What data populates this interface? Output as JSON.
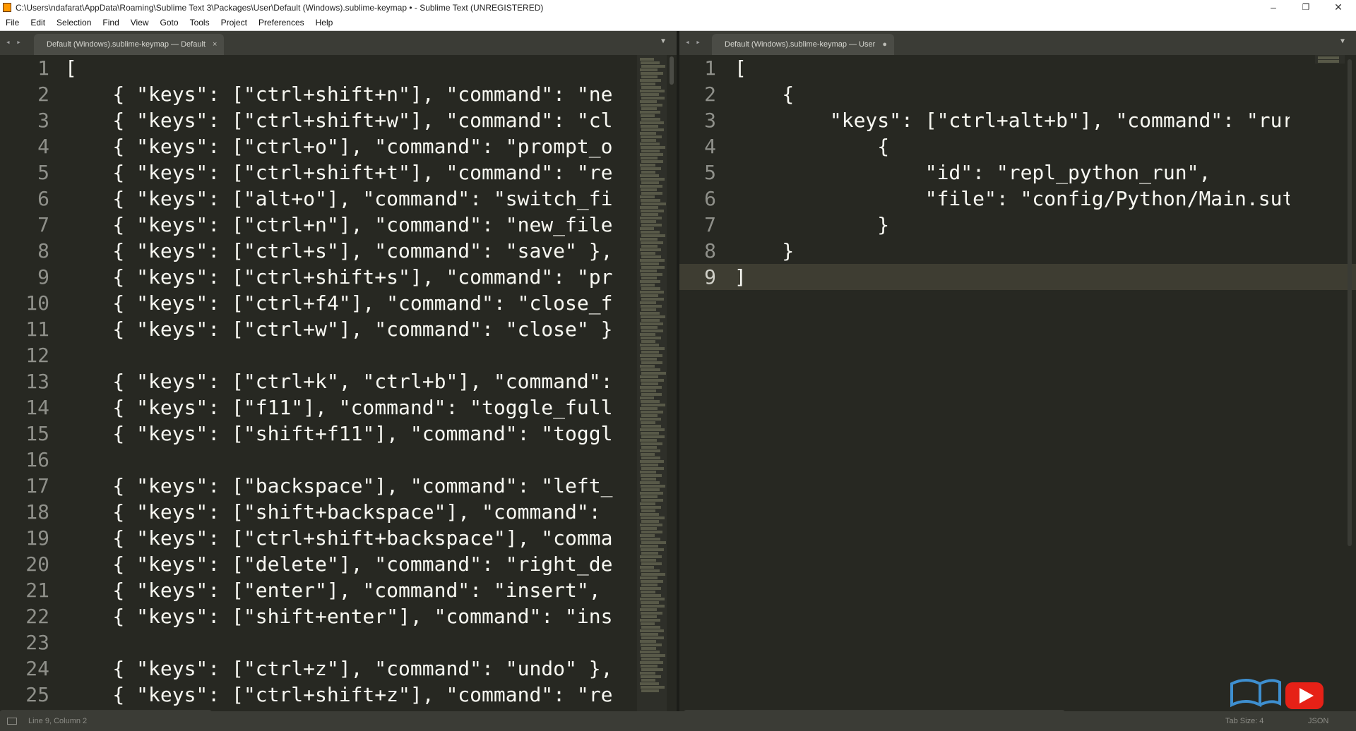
{
  "window": {
    "title": "C:\\Users\\ndafarat\\AppData\\Roaming\\Sublime Text 3\\Packages\\User\\Default (Windows).sublime-keymap • - Sublime Text (UNREGISTERED)",
    "controls": {
      "minimize": "–",
      "maximize": "❐",
      "close": "✕"
    }
  },
  "menu": [
    "File",
    "Edit",
    "Selection",
    "Find",
    "View",
    "Goto",
    "Tools",
    "Project",
    "Preferences",
    "Help"
  ],
  "left_pane": {
    "tab_nav": "◂ ▸",
    "tab_label": "Default (Windows).sublime-keymap — Default",
    "tab_close": "×",
    "dropdown": "▼",
    "lines": [
      "[",
      "    { \"keys\": [\"ctrl+shift+n\"], \"command\": \"ne",
      "    { \"keys\": [\"ctrl+shift+w\"], \"command\": \"cl",
      "    { \"keys\": [\"ctrl+o\"], \"command\": \"prompt_o",
      "    { \"keys\": [\"ctrl+shift+t\"], \"command\": \"re",
      "    { \"keys\": [\"alt+o\"], \"command\": \"switch_fi",
      "    { \"keys\": [\"ctrl+n\"], \"command\": \"new_file",
      "    { \"keys\": [\"ctrl+s\"], \"command\": \"save\" },",
      "    { \"keys\": [\"ctrl+shift+s\"], \"command\": \"pr",
      "    { \"keys\": [\"ctrl+f4\"], \"command\": \"close_f",
      "    { \"keys\": [\"ctrl+w\"], \"command\": \"close\" }",
      "",
      "    { \"keys\": [\"ctrl+k\", \"ctrl+b\"], \"command\":",
      "    { \"keys\": [\"f11\"], \"command\": \"toggle_full",
      "    { \"keys\": [\"shift+f11\"], \"command\": \"toggl",
      "",
      "    { \"keys\": [\"backspace\"], \"command\": \"left_",
      "    { \"keys\": [\"shift+backspace\"], \"command\":",
      "    { \"keys\": [\"ctrl+shift+backspace\"], \"comma",
      "    { \"keys\": [\"delete\"], \"command\": \"right_de",
      "    { \"keys\": [\"enter\"], \"command\": \"insert\",",
      "    { \"keys\": [\"shift+enter\"], \"command\": \"ins",
      "",
      "    { \"keys\": [\"ctrl+z\"], \"command\": \"undo\" },",
      "    { \"keys\": [\"ctrl+shift+z\"], \"command\": \"re"
    ]
  },
  "right_pane": {
    "tab_nav": "◂ ▸",
    "tab_label": "Default (Windows).sublime-keymap — User",
    "tab_close": "●",
    "dropdown": "▼",
    "lines": [
      "[",
      "    {",
      "        \"keys\": [\"ctrl+alt+b\"], \"command\": \"rur",
      "            {",
      "                \"id\": \"repl_python_run\",",
      "                \"file\": \"config/Python/Main.sut",
      "            }",
      "    }",
      "]"
    ],
    "active_line": 9
  },
  "status": {
    "position": "Line 9, Column 2",
    "tab_size": "Tab Size: 4",
    "syntax": "JSON"
  },
  "colors": {
    "editor_bg": "#272822",
    "text": "#f8f8f2",
    "gutter_text": "#8f908a",
    "tabbar_bg": "#3b3c36",
    "watermark_red": "#e62117",
    "watermark_blue": "#3e8fd0"
  }
}
